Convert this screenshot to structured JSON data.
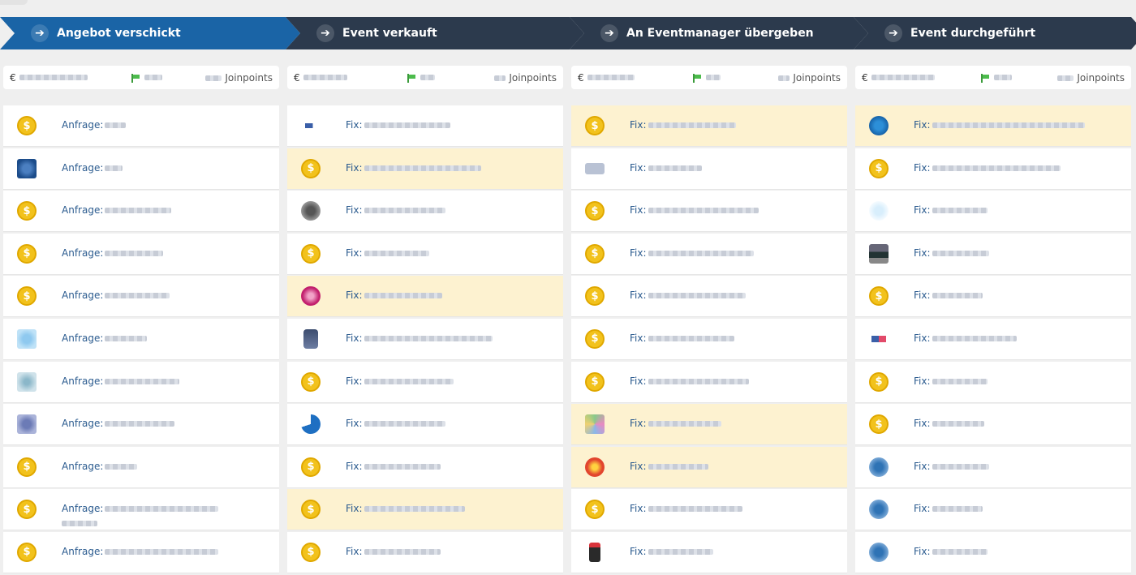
{
  "stages": [
    {
      "label": "Angebot verschickt",
      "color": "#1a64a6"
    },
    {
      "label": "Event verkauft",
      "color": "#2c3a4d"
    },
    {
      "label": "An Eventmanager übergeben",
      "color": "#2c3a4d"
    },
    {
      "label": "Event durchgeführt",
      "color": "#2c3a4d"
    }
  ],
  "summaries": [
    {
      "currency": "€",
      "points_label": "Joinpoints"
    },
    {
      "currency": "€",
      "points_label": "Joinpoints"
    },
    {
      "currency": "€",
      "points_label": "Joinpoints"
    },
    {
      "currency": "€",
      "points_label": "Joinpoints"
    }
  ],
  "columns": [
    {
      "prefix": "Anfrage:",
      "cards": [
        {
          "icon": "coin-icon",
          "highlight": false
        },
        {
          "icon": "company-logo-icon",
          "highlight": false
        },
        {
          "icon": "coin-icon",
          "highlight": false
        },
        {
          "icon": "coin-icon",
          "highlight": false
        },
        {
          "icon": "coin-icon",
          "highlight": false
        },
        {
          "icon": "company-logo-icon",
          "highlight": false
        },
        {
          "icon": "company-logo-icon",
          "highlight": false
        },
        {
          "icon": "company-logo-icon",
          "highlight": false
        },
        {
          "icon": "coin-icon",
          "highlight": false
        },
        {
          "icon": "coin-icon",
          "highlight": false
        },
        {
          "icon": "coin-icon",
          "highlight": false
        }
      ]
    },
    {
      "prefix": "Fix:",
      "cards": [
        {
          "icon": "company-logo-icon",
          "highlight": false
        },
        {
          "icon": "coin-icon",
          "highlight": true
        },
        {
          "icon": "company-logo-icon",
          "highlight": false
        },
        {
          "icon": "coin-icon",
          "highlight": false
        },
        {
          "icon": "company-logo-icon",
          "highlight": true
        },
        {
          "icon": "company-logo-icon",
          "highlight": false
        },
        {
          "icon": "coin-icon",
          "highlight": false
        },
        {
          "icon": "company-logo-icon",
          "highlight": false
        },
        {
          "icon": "coin-icon",
          "highlight": false
        },
        {
          "icon": "coin-icon",
          "highlight": true
        },
        {
          "icon": "coin-icon",
          "highlight": false
        }
      ]
    },
    {
      "prefix": "Fix:",
      "cards": [
        {
          "icon": "coin-icon",
          "highlight": true
        },
        {
          "icon": "company-logo-icon",
          "highlight": false
        },
        {
          "icon": "coin-icon",
          "highlight": false
        },
        {
          "icon": "coin-icon",
          "highlight": false
        },
        {
          "icon": "coin-icon",
          "highlight": false
        },
        {
          "icon": "coin-icon",
          "highlight": false
        },
        {
          "icon": "coin-icon",
          "highlight": false
        },
        {
          "icon": "company-logo-icon",
          "highlight": true
        },
        {
          "icon": "company-logo-icon",
          "highlight": true
        },
        {
          "icon": "coin-icon",
          "highlight": false
        },
        {
          "icon": "company-logo-icon",
          "highlight": false
        }
      ]
    },
    {
      "prefix": "Fix:",
      "cards": [
        {
          "icon": "company-logo-icon",
          "highlight": true
        },
        {
          "icon": "coin-icon",
          "highlight": false
        },
        {
          "icon": "company-logo-icon",
          "highlight": false
        },
        {
          "icon": "company-logo-icon",
          "highlight": false
        },
        {
          "icon": "coin-icon",
          "highlight": false
        },
        {
          "icon": "company-logo-icon",
          "highlight": false
        },
        {
          "icon": "coin-icon",
          "highlight": false
        },
        {
          "icon": "coin-icon",
          "highlight": false
        },
        {
          "icon": "company-logo-icon",
          "highlight": false
        },
        {
          "icon": "company-logo-icon",
          "highlight": false
        },
        {
          "icon": "company-logo-icon",
          "highlight": false
        }
      ]
    }
  ],
  "colors": {
    "active_stage": "#1a64a6",
    "inactive_stage": "#2c3a4d",
    "highlight_card": "#fdf2d0",
    "coin": "#f2c21c"
  }
}
